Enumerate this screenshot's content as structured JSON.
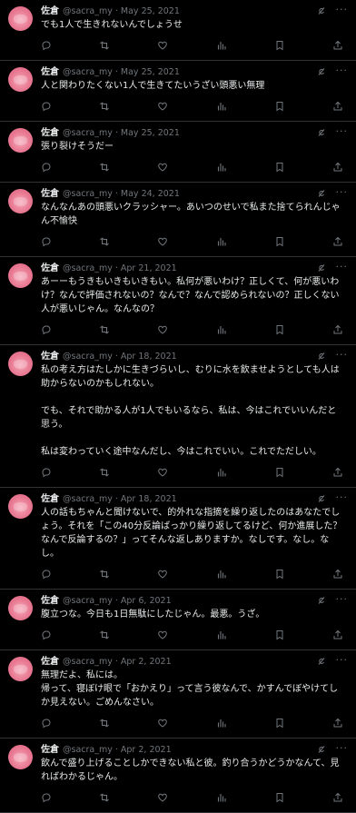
{
  "icons": {
    "avatar": "pink-circle-avatar",
    "grok": "grok-icon",
    "more": "more-icon",
    "reply": "reply-icon",
    "retweet": "retweet-icon",
    "like": "like-icon",
    "views": "views-icon",
    "bookmark": "bookmark-icon",
    "share": "share-icon"
  },
  "colors": {
    "background": "#000000",
    "text": "#e7e9ea",
    "muted": "#71767b",
    "avatar": "#e87892"
  },
  "tweets": [
    {
      "name": "佐倉",
      "meta": "@sacra_my · May 25, 2021",
      "text": "でも1人で生きれないんでしょうせ"
    },
    {
      "name": "佐倉",
      "meta": "@sacra_my · May 25, 2021",
      "text": "人と関わりたくない1人で生きてたいうざい頭悪い無理"
    },
    {
      "name": "佐倉",
      "meta": "@sacra_my · May 25, 2021",
      "text": "張り裂けそうだー"
    },
    {
      "name": "佐倉",
      "meta": "@sacra_my · May 24, 2021",
      "text": "なんなんあの頭悪いクラッシャー。あいつのせいで私また捨てられんじゃん不愉快"
    },
    {
      "name": "佐倉",
      "meta": "@sacra_my · Apr 21, 2021",
      "text": "あーーもうきもいきもいきもい。私何が悪いわけ？正しくて、何が悪いわけ？なんで評価されないの？なんで？なんで認められないの？正しくない人が悪いじゃん。なんなの？"
    },
    {
      "name": "佐倉",
      "meta": "@sacra_my · Apr 18, 2021",
      "text": "私の考え方はたしかに生きづらいし、むりに水を飲ませようとしても人は助からないのかもしれない。\n\nでも、それで助かる人が1人でもいるなら、私は、今はこれでいいんだと思う。\n\n私は変わっていく途中なんだし、今はこれでいい。これでただしい。"
    },
    {
      "name": "佐倉",
      "meta": "@sacra_my · Apr 18, 2021",
      "text": "人の話もちゃんと聞けないで、的外れな指摘を繰り返したのはあなたでしょう。それを「この40分反論ばっかり繰り返してるけど、何か進展した？なんで反論するの？」ってそんな返しありますか。なしです。なし。なし。"
    },
    {
      "name": "佐倉",
      "meta": "@sacra_my · Apr 6, 2021",
      "text": "腹立つな。今日も1日無駄にしたじゃん。最悪。うざ。"
    },
    {
      "name": "佐倉",
      "meta": "@sacra_my · Apr 2, 2021",
      "text": "無理だよ、私には。\n帰って、寝ぼけ眼で「おかえり」って言う彼なんで、かすんでぼやけてしか見えない。ごめんなさい。"
    },
    {
      "name": "佐倉",
      "meta": "@sacra_my · Apr 2, 2021",
      "text": "飲んで盛り上げることしかできない私と彼。釣り合うかどうかなんて、見ればわかるじゃん。"
    }
  ]
}
